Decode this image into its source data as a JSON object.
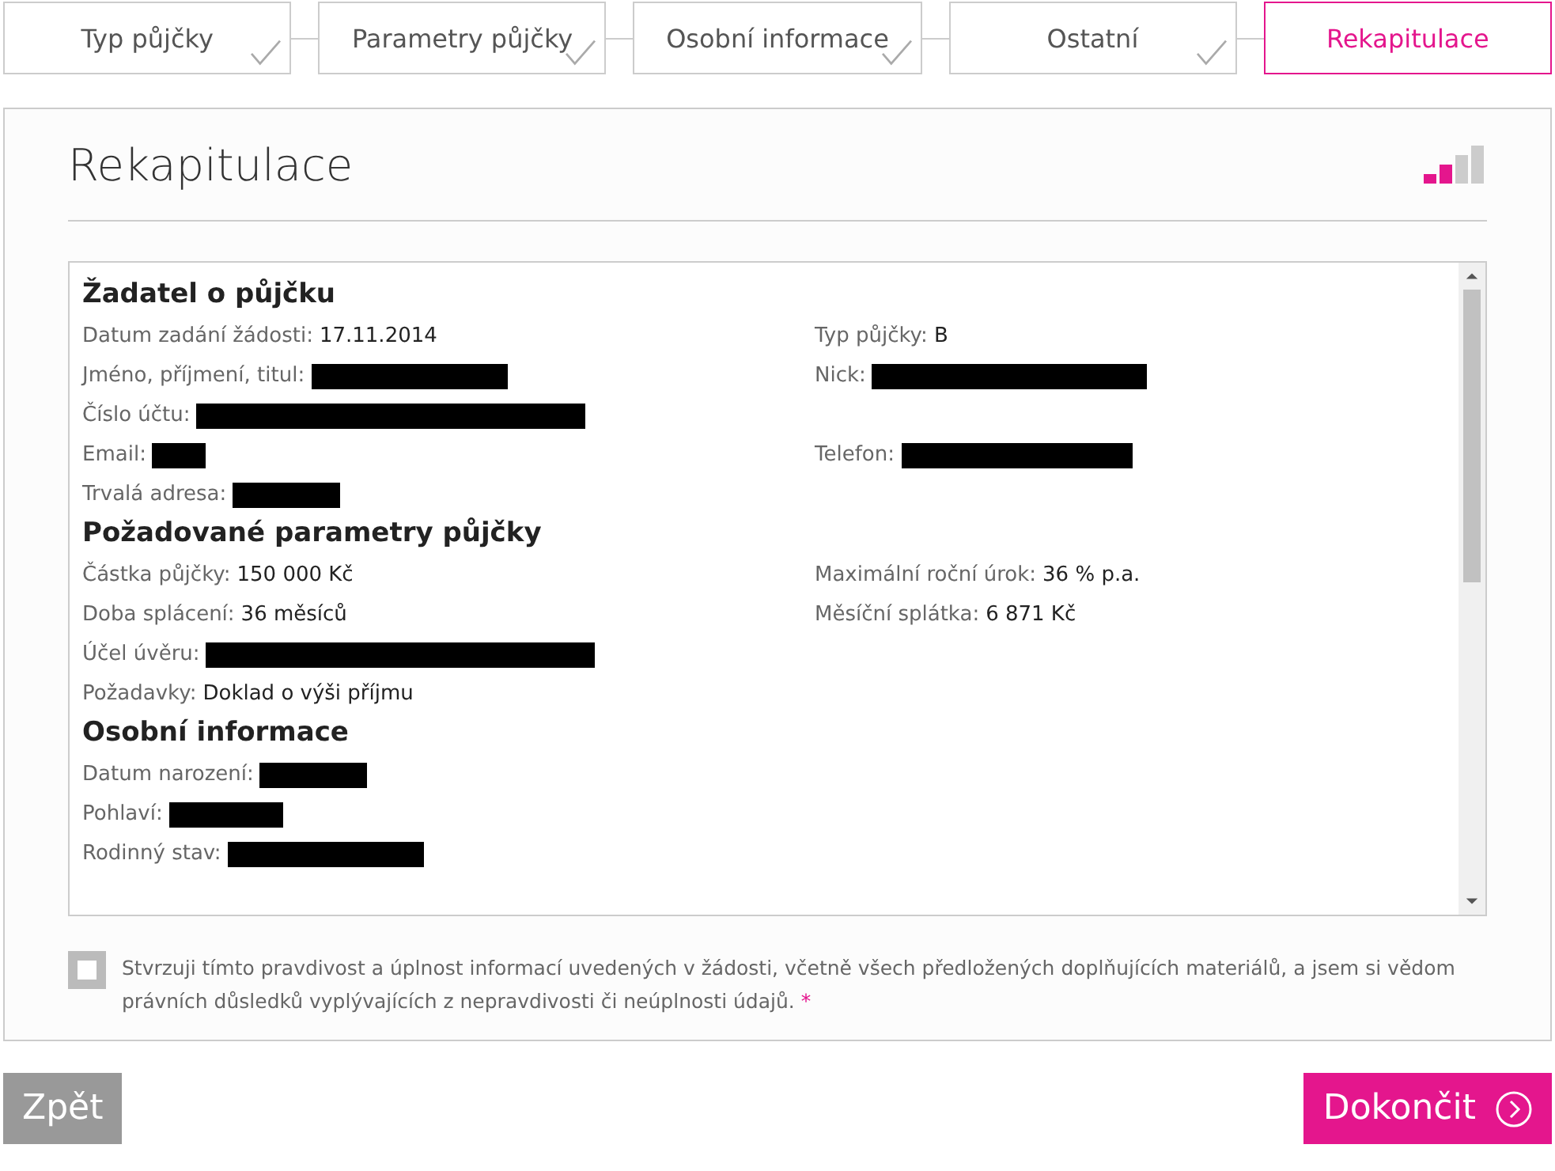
{
  "steps": [
    {
      "label": "Typ půjčky",
      "done": true,
      "selected": false
    },
    {
      "label": "Parametry půjčky",
      "done": true,
      "selected": false
    },
    {
      "label": "Osobní informace",
      "done": true,
      "selected": false
    },
    {
      "label": "Ostatní",
      "done": true,
      "selected": false
    },
    {
      "label": "Rekapitulace",
      "done": false,
      "selected": true
    }
  ],
  "page_title": "Rekapitulace",
  "progress": {
    "level": 0.5
  },
  "sections": [
    {
      "heading": "Žadatel o půjčku",
      "rows": [
        {
          "left": {
            "label": "Datum zadání žádosti:",
            "value": "17.11.2014"
          },
          "right": {
            "label": "Typ půjčky:",
            "value": "B"
          }
        },
        {
          "left": {
            "label": "Jméno, příjmení, titul:",
            "redacted": true
          },
          "right": {
            "label": "Nick:",
            "redacted": true
          }
        },
        {
          "left": {
            "label": "Číslo účtu:",
            "redacted": true
          }
        },
        {
          "left": {
            "label": "Email:",
            "redacted": true
          },
          "right": {
            "label": "Telefon:",
            "redacted": true
          }
        },
        {
          "left": {
            "label": "Trvalá adresa:",
            "redacted": true
          }
        }
      ]
    },
    {
      "heading": "Požadované parametry půjčky",
      "rows": [
        {
          "left": {
            "label": "Částka půjčky:",
            "value": "150 000 Kč"
          },
          "right": {
            "label": "Maximální roční úrok:",
            "value": "36 % p.a."
          }
        },
        {
          "left": {
            "label": "Doba splácení:",
            "value": "36 měsíců"
          },
          "right": {
            "label": "Měsíční splátka:",
            "value": "6 871 Kč"
          }
        },
        {
          "left": {
            "label": "Účel úvěru:",
            "redacted": true
          }
        },
        {
          "left": {
            "label": "Požadavky:",
            "value": "Doklad o výši příjmu"
          }
        }
      ]
    },
    {
      "heading": "Osobní informace",
      "rows": [
        {
          "left": {
            "label": "Datum narození:",
            "redacted": true
          }
        },
        {
          "left": {
            "label": "Pohlaví:",
            "redacted": true
          }
        },
        {
          "left": {
            "label": "Rodinný stav:",
            "redacted": true
          }
        }
      ]
    }
  ],
  "confirm": {
    "checked": false,
    "text": "Stvrzuji tímto pravdivost a úplnost informací uvedených v žádosti, včetně všech předložených doplňujících materiálů, a jsem si vědom právních důsledků vyplývajících z nepravdivosti či neúplnosti údajů.",
    "required_mark": "*"
  },
  "buttons": {
    "back": "Zpět",
    "finish": "Dokončit"
  }
}
